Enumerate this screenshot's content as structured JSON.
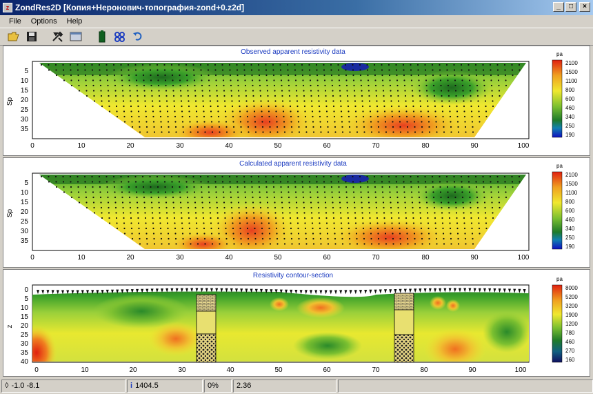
{
  "window": {
    "title": "ZondRes2D [Копия+Неронович-топография-zond+0.z2d]",
    "app_icon_text": "z",
    "minimize": "_",
    "maximize": "□",
    "close": "×"
  },
  "menu": {
    "items": [
      "File",
      "Options",
      "Help"
    ]
  },
  "toolbar": {
    "icons": [
      "open-folder-icon",
      "save-disk-icon",
      "tools-icon",
      "window-icon",
      "battery-icon",
      "pattern-icon",
      "undo-icon"
    ]
  },
  "colors": {
    "blue": "#1a1aa0",
    "darkgreen": "#1e6a1e",
    "green": "#3aa02a",
    "lightgreen": "#9ad03a",
    "yellow": "#f0e830",
    "orange": "#f0a020",
    "red": "#e03018"
  },
  "panels": [
    {
      "title": "Observed apparent resistivity data",
      "ylabel": "Sp",
      "unit": "pa",
      "yticks": [
        "5",
        "10",
        "15",
        "20",
        "25",
        "30",
        "35"
      ],
      "xticks": [
        "0",
        "10",
        "20",
        "30",
        "40",
        "50",
        "60",
        "70",
        "80",
        "90",
        "100"
      ],
      "legend": [
        "2100",
        "1500",
        "1100",
        "800",
        "600",
        "460",
        "340",
        "250",
        "190"
      ]
    },
    {
      "title": "Calculated apparent resistivity data",
      "ylabel": "Sp",
      "unit": "pa",
      "yticks": [
        "5",
        "10",
        "15",
        "20",
        "25",
        "30",
        "35"
      ],
      "xticks": [
        "0",
        "10",
        "20",
        "30",
        "40",
        "50",
        "60",
        "70",
        "80",
        "90",
        "100"
      ],
      "legend": [
        "2100",
        "1500",
        "1100",
        "800",
        "600",
        "460",
        "340",
        "250",
        "190"
      ]
    },
    {
      "title": "Resistivity contour-section",
      "ylabel": "z",
      "unit": "pa",
      "yticks": [
        "0",
        "5",
        "10",
        "15",
        "20",
        "25",
        "30",
        "35",
        "40"
      ],
      "xticks": [
        "0",
        "10",
        "20",
        "30",
        "40",
        "50",
        "60",
        "70",
        "80",
        "90",
        "100"
      ],
      "legend": [
        "8000",
        "5200",
        "3200",
        "1900",
        "1200",
        "780",
        "460",
        "270",
        "160"
      ]
    }
  ],
  "status": {
    "coords": "-1.0 -8.1",
    "value": "1404.5",
    "percent_label": "0%",
    "rms": "2.36"
  }
}
